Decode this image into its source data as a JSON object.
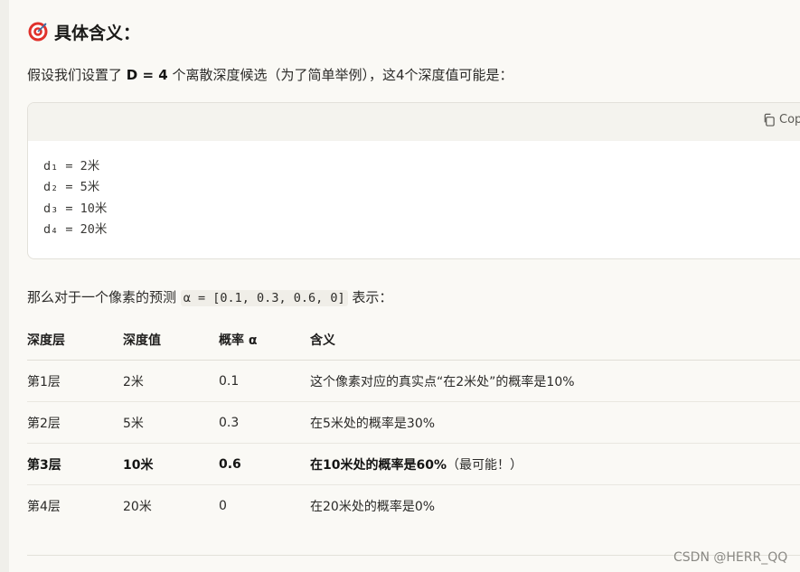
{
  "section": {
    "icon": "target-icon",
    "title": "具体含义："
  },
  "intro": {
    "pre": "假设我们设置了 ",
    "bold": "D = 4",
    "post": " 个离散深度候选（为了简单举例），这4个深度值可能是："
  },
  "code_block": {
    "copy_label": "Copy",
    "lines": [
      "d₁ = 2米",
      "d₂ = 5米",
      "d₃ = 10米",
      "d₄ = 20米"
    ]
  },
  "prediction": {
    "pre": "那么对于一个像素的预测 ",
    "code": "α = [0.1, 0.3, 0.6, 0]",
    "post": " 表示："
  },
  "table": {
    "headers": [
      "深度层",
      "深度值",
      "概率 α",
      "含义"
    ],
    "rows": [
      {
        "layer": "第1层",
        "depth": "2米",
        "prob": "0.1",
        "meaning": "这个像素对应的真实点“在2米处”的概率是10%",
        "extra": ""
      },
      {
        "layer": "第2层",
        "depth": "5米",
        "prob": "0.3",
        "meaning": "在5米处的概率是30%",
        "extra": ""
      },
      {
        "layer": "第3层",
        "depth": "10米",
        "prob": "0.6",
        "meaning": "在10米处的概率是60%",
        "extra": "（最可能！）"
      },
      {
        "layer": "第4层",
        "depth": "20米",
        "prob": "0",
        "meaning": "在20米处的概率是0%",
        "extra": ""
      }
    ]
  },
  "watermark": "CSDN @HERR_QQ"
}
